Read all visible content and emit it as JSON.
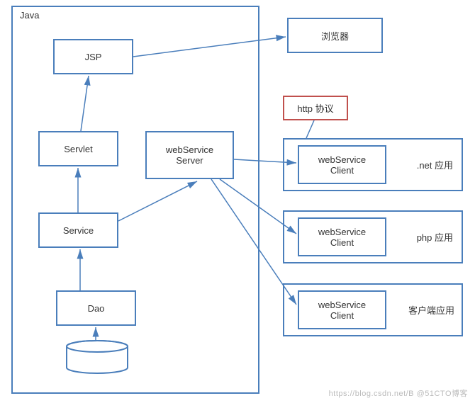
{
  "container": {
    "label": "Java"
  },
  "nodes": {
    "jsp": "JSP",
    "servlet": "Servlet",
    "service": "Service",
    "dao": "Dao",
    "wsServer": "webService\nServer",
    "wsClient1": "webService\nClient",
    "wsClient2": "webService\nClient",
    "wsClient3": "webService\nClient",
    "browser": "浏览器",
    "httpProto": "http 协议",
    "netApp": ".net 应用",
    "phpApp": "php 应用",
    "mobileApp": "客户端应用"
  },
  "watermark": "https://blog.csdn.net/B @51CTO博客",
  "colors": {
    "blue": "#4a7ebb",
    "red": "#c0504d"
  }
}
